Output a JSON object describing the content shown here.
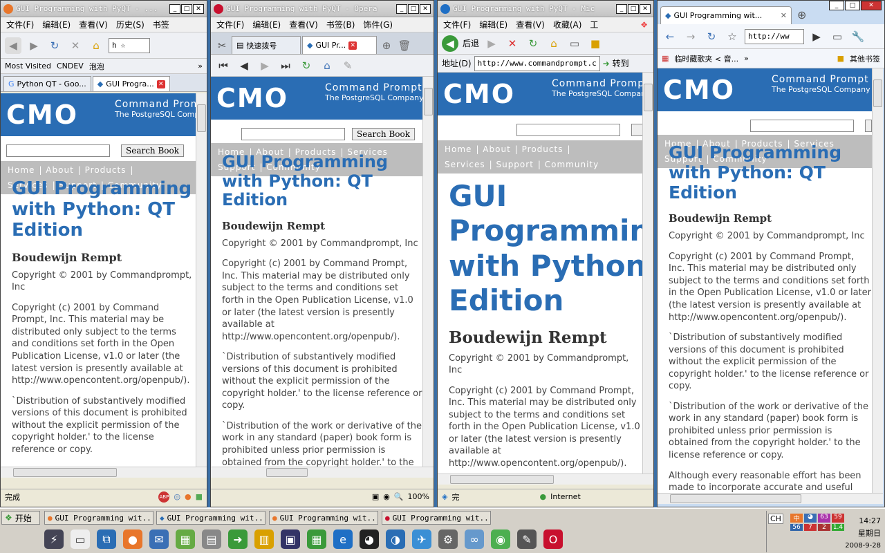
{
  "windows": [
    {
      "id": "firefox",
      "title": "GUI Programming with PyQT - ...",
      "menu": [
        "文件(F)",
        "编辑(E)",
        "查看(V)",
        "历史(S)",
        "书签"
      ],
      "url_text": "h",
      "bookmarks": [
        "Most Visited",
        "CNDEV",
        "泡泡"
      ],
      "tabs": [
        {
          "label": "Python QT - Goo..."
        },
        {
          "label": "GUI Progra..."
        }
      ],
      "status": "完成",
      "accent": "#e8762b"
    },
    {
      "id": "opera",
      "title": "GUI Programming with PyQT - Opera",
      "menu": [
        "文件(F)",
        "编辑(E)",
        "查看(V)",
        "书签(B)",
        "饰件(G)"
      ],
      "tabs": [
        {
          "label": "快速拨号"
        },
        {
          "label": "GUI Pr..."
        }
      ],
      "zoom": "100%",
      "accent": "#c8102e"
    },
    {
      "id": "ie",
      "title": "GUI Programming with PyQT - Mic",
      "menu": [
        "文件(F)",
        "编辑(E)",
        "查看(V)",
        "收藏(A)",
        "工"
      ],
      "back_label": "后退",
      "address_label": "地址(D)",
      "url": "http://www.commandprompt.c",
      "go_label": "转到",
      "status": "完",
      "zone": "Internet",
      "accent": "#1f6fc5"
    },
    {
      "id": "chrome",
      "tab_title": "GUI Programming wit...",
      "url": "http://ww",
      "bookmarks": [
        "临时藏歌夹 < 音...",
        "其他书签"
      ],
      "accent": "#4caf50"
    }
  ],
  "page": {
    "logo": "CMO",
    "brand_line1": "Command Prompt",
    "brand_line2": "The PostgreSQL Company",
    "search_button": "Search Book",
    "nav": [
      "Home",
      "About",
      "Products",
      "Services",
      "Support",
      "Community"
    ],
    "title": "GUI Programming with Python: QT Edition",
    "author": "Boudewijn Rempt",
    "copyright": "Copyright © 2001 by Commandprompt, Inc",
    "para1": "Copyright (c) 2001 by Command Prompt, Inc. This material may be distributed only subject to the terms and conditions set forth in the Open Publication License, v1.0 or later (the latest version is presently available at http://www.opencontent.org/openpub/).",
    "para2": "`Distribution of substantively modified versions of this document is prohibited without the explicit permission of the copyright holder.' to the license reference or copy.",
    "para3": "`Distribution of the work or derivative of the work in any standard (paper) book form is prohibited unless prior permission is obtained from the copyright holder.' to the license reference or copy.",
    "para4": "Although every reasonable effort has been made to incorporate accurate and useful information into this book, the copyright holders make no representation"
  },
  "taskbar": {
    "start": "开始",
    "tasks": [
      "GUI Programming wit...",
      "GUI Programming wit...",
      "GUI Programming wit...",
      "GUI Programming wit..."
    ],
    "time": "14:27",
    "weekday": "星期日",
    "date": "2008-9-28",
    "tray_numbers": [
      "63",
      "59",
      "56",
      "7",
      "2",
      "1.4"
    ]
  }
}
